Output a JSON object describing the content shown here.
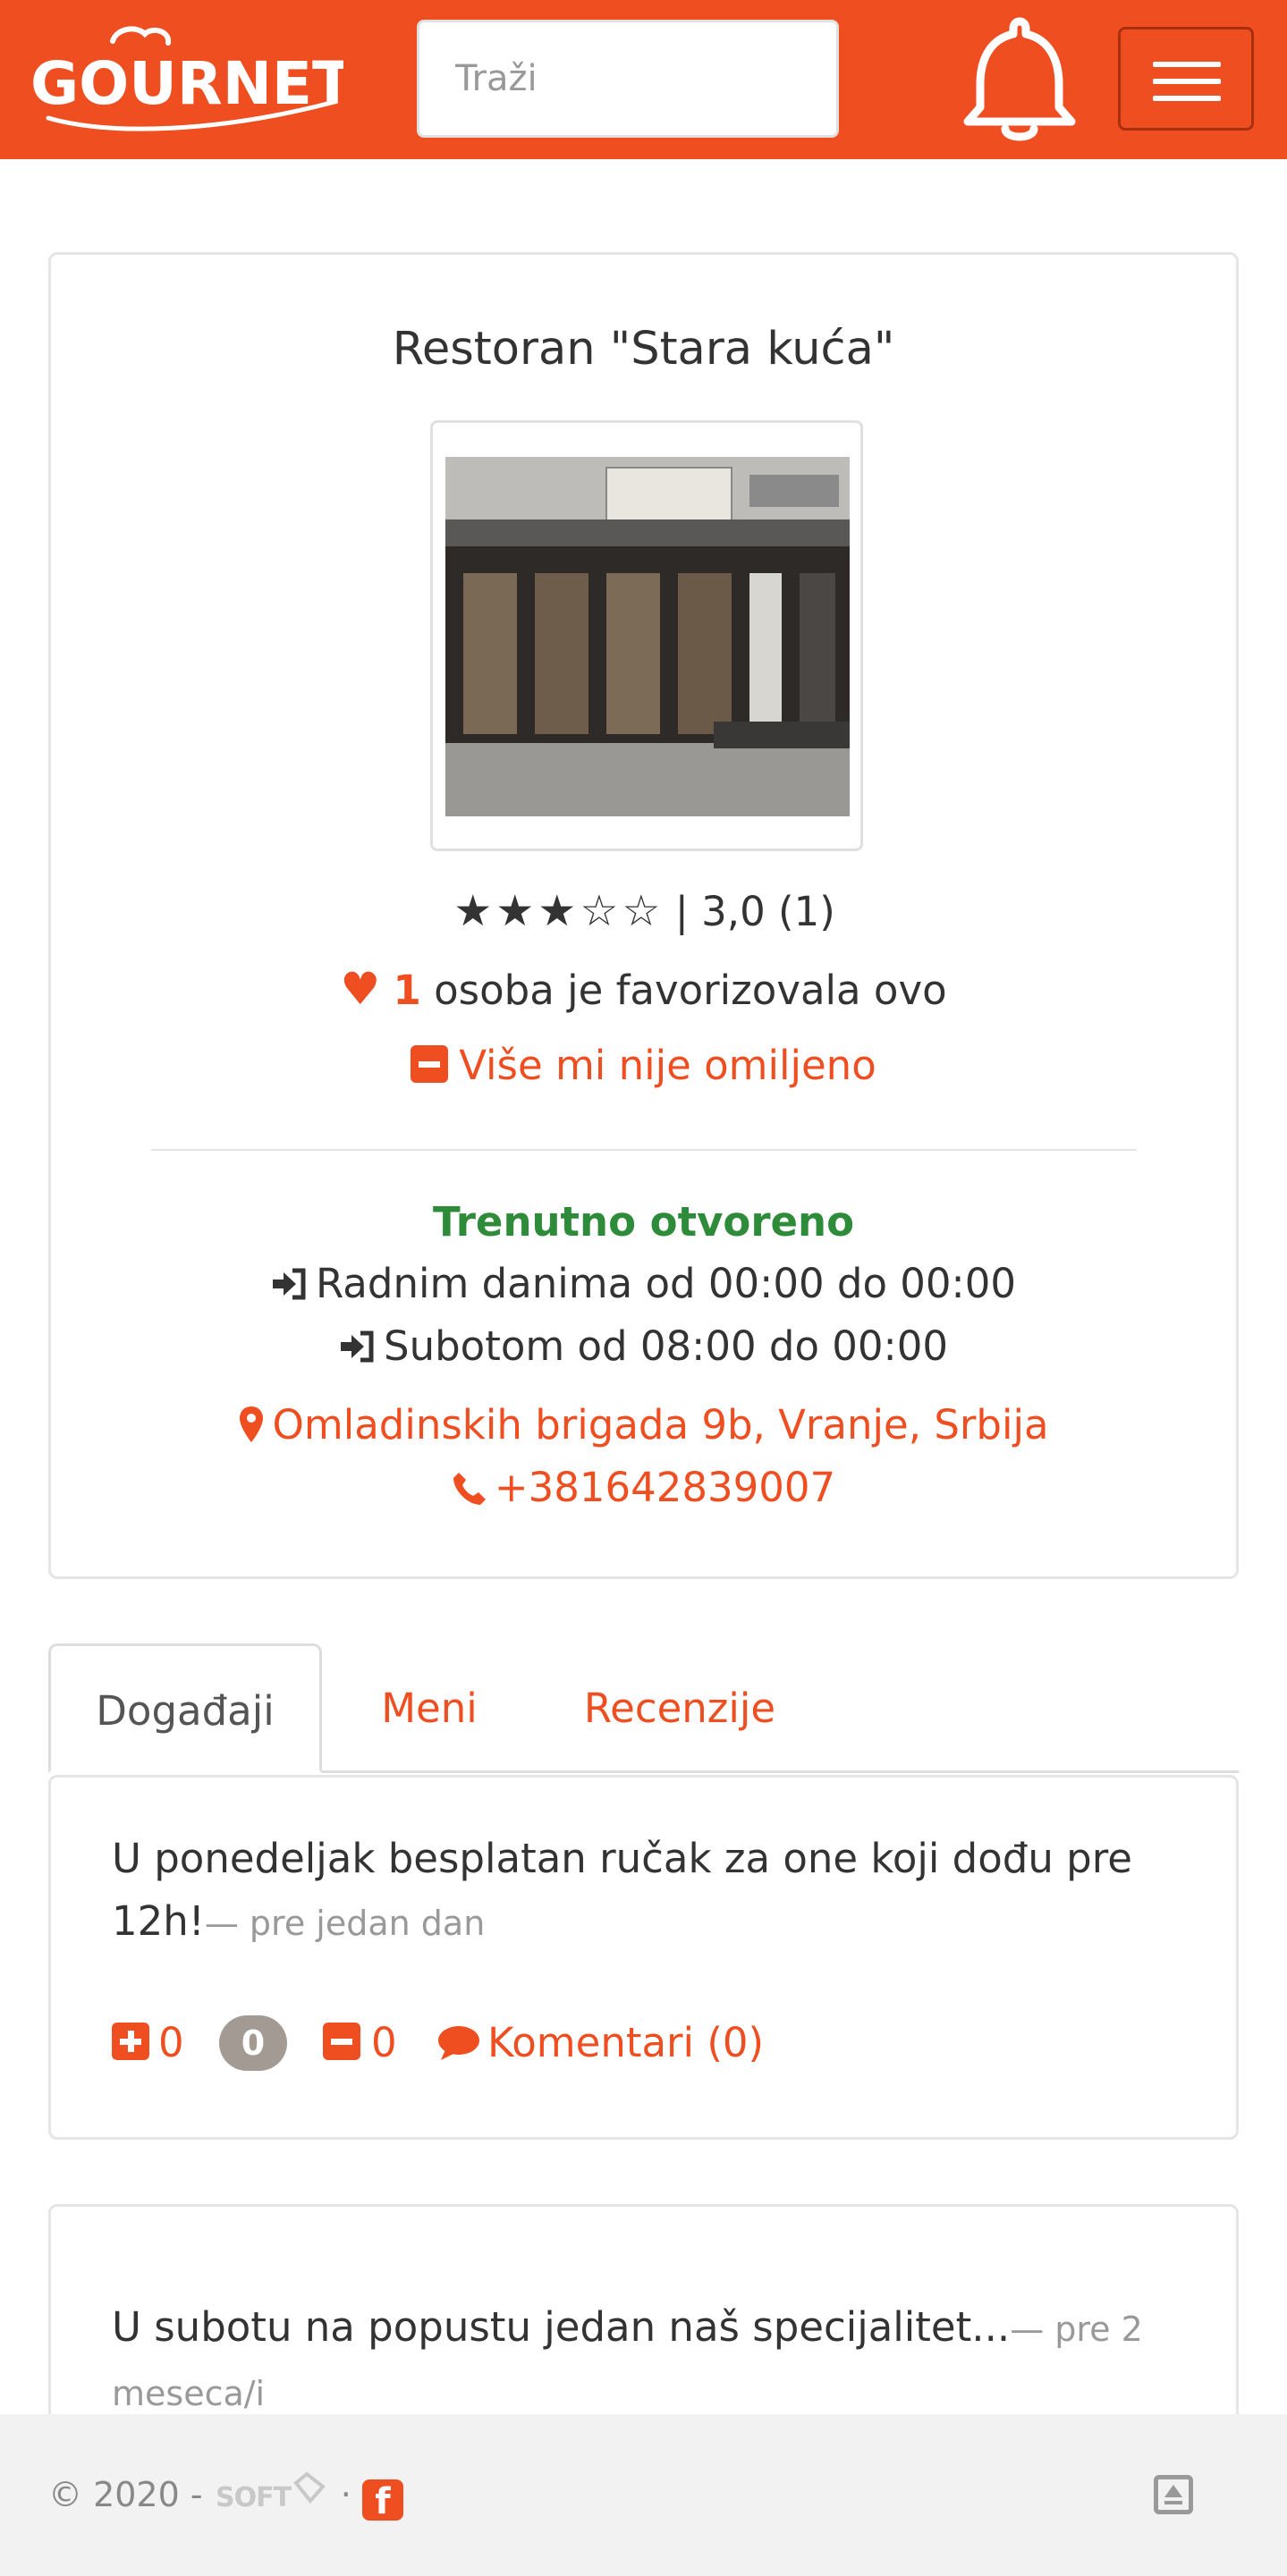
{
  "navbar": {
    "logo_text": "GOURNET",
    "search_placeholder": "Traži",
    "bell_icon": "bell-icon",
    "menu_icon": "hamburger-menu-icon",
    "brand_color": "#ee4e20"
  },
  "restaurant": {
    "title": "Restoran \"Stara kuća\"",
    "rating": {
      "stars_filled": 3,
      "stars_total": 5,
      "text": "| 3,0 (1)"
    },
    "favorites": {
      "count": "1",
      "text": "osoba je favorizovala ovo"
    },
    "unfavorite_label": "Više mi nije omiljeno",
    "status": "Trenutno otvoreno",
    "status_color": "#2e8b3a",
    "hours": [
      "Radnim danima od 00:00 do 00:00",
      "Subotom od 08:00 do 00:00"
    ],
    "address": "Omladinskih brigada 9b, Vranje, Srbija",
    "phone": "+381642839007"
  },
  "tabs": [
    {
      "label": "Događaji",
      "active": true
    },
    {
      "label": "Meni",
      "active": false
    },
    {
      "label": "Recenzije",
      "active": false
    }
  ],
  "events": [
    {
      "text": "U ponedeljak besplatan ručak za one koji dođu pre 12h!",
      "time_ago": "— pre jedan dan",
      "upvotes": "0",
      "score": "0",
      "downvotes": "0",
      "comments_label": "Komentari (0)"
    },
    {
      "text": "U subotu na popustu jedan naš specijalitet...",
      "time_ago": "— pre 2 meseca/i"
    }
  ],
  "footer": {
    "copyright": "© 2020 -",
    "dot": "·",
    "facebook_letter": "f"
  }
}
